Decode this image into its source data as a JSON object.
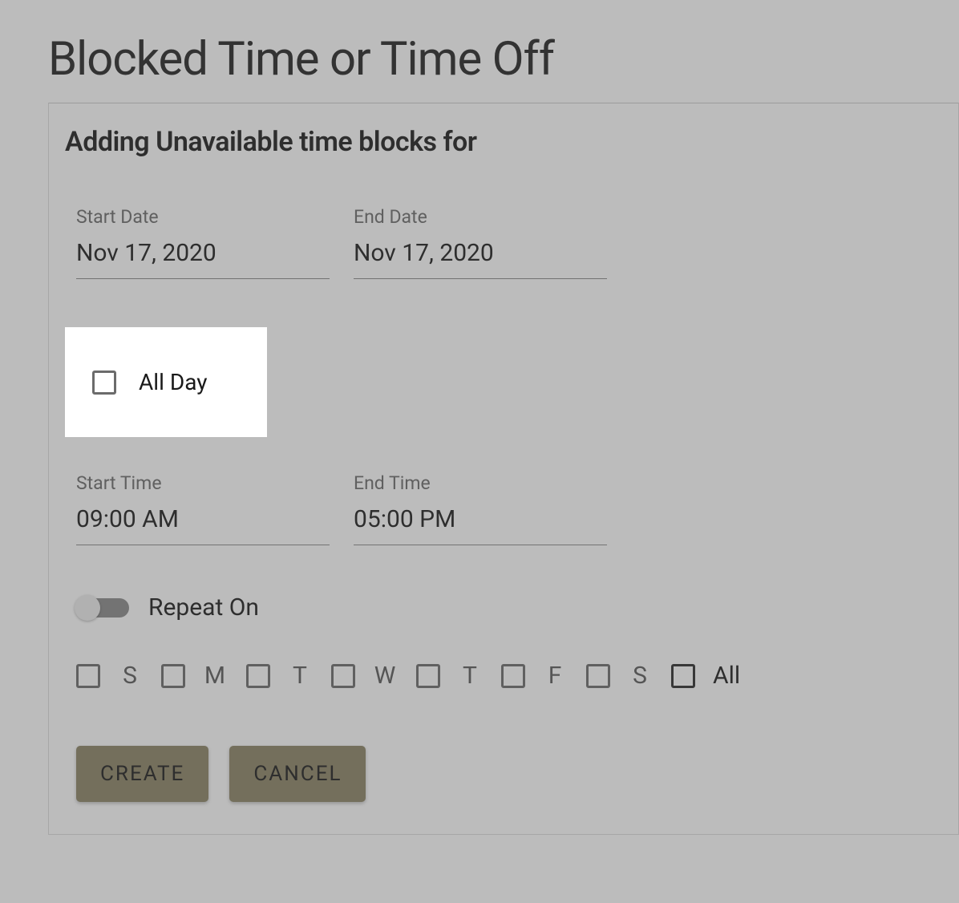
{
  "page": {
    "title": "Blocked Time or Time Off"
  },
  "form": {
    "heading": "Adding Unavailable time blocks for",
    "fields": {
      "start_date": {
        "label": "Start Date",
        "value": "Nov 17, 2020"
      },
      "end_date": {
        "label": "End Date",
        "value": "Nov 17, 2020"
      },
      "start_time": {
        "label": "Start Time",
        "value": "09:00 AM"
      },
      "end_time": {
        "label": "End Time",
        "value": "05:00 PM"
      }
    },
    "all_day": {
      "label": "All Day",
      "checked": false
    },
    "repeat": {
      "label": "Repeat On",
      "enabled": false
    },
    "days": [
      {
        "label": "S"
      },
      {
        "label": "M"
      },
      {
        "label": "T"
      },
      {
        "label": "W"
      },
      {
        "label": "T"
      },
      {
        "label": "F"
      },
      {
        "label": "S"
      }
    ],
    "days_all": {
      "label": "All"
    },
    "buttons": {
      "create": "CREATE",
      "cancel": "CANCEL"
    }
  }
}
